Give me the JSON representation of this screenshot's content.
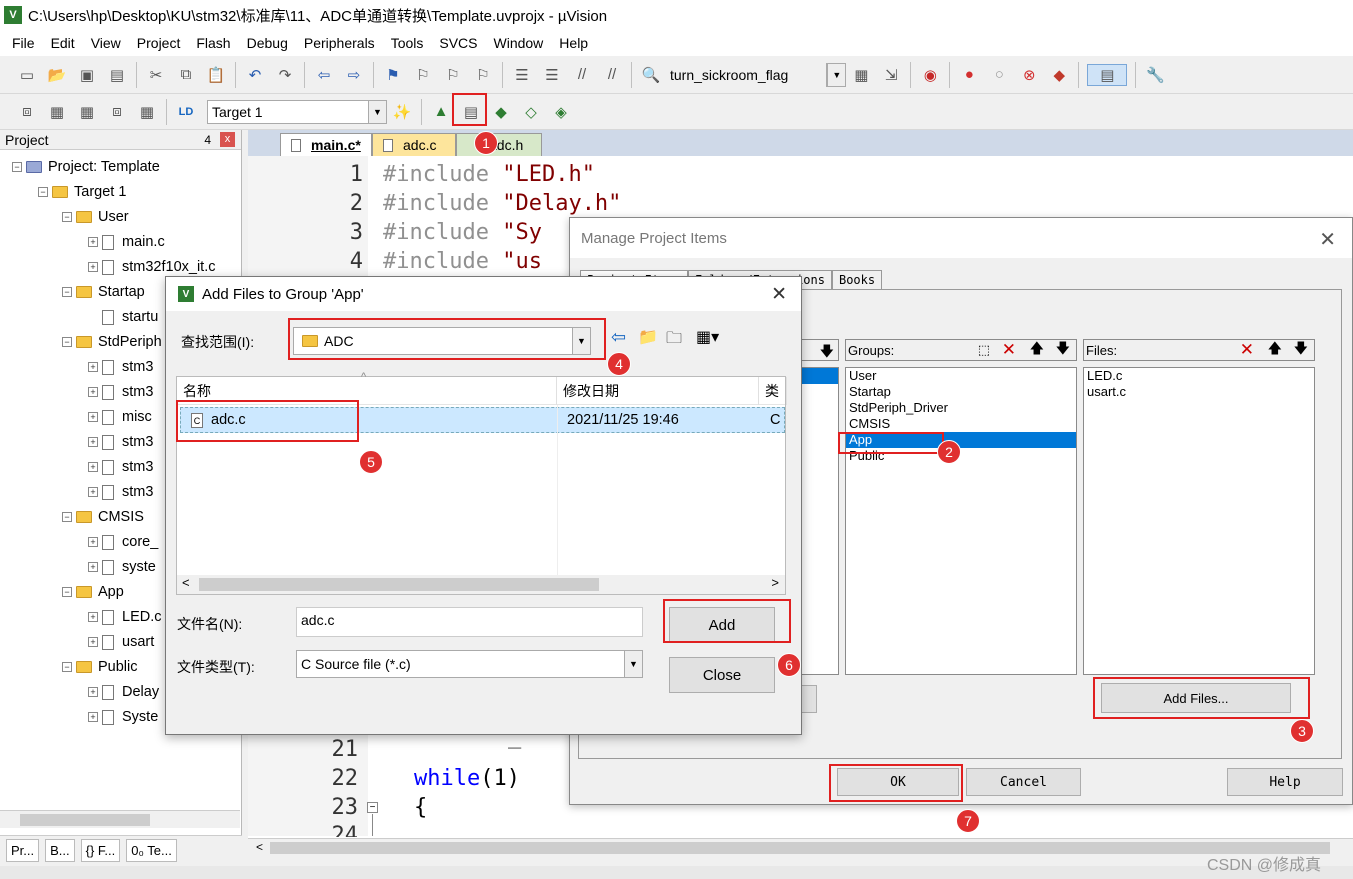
{
  "window": {
    "title": "C:\\Users\\hp\\Desktop\\KU\\stm32\\标准库\\11、ADC单通道转换\\Template.uvprojx - µVision"
  },
  "menu": [
    "File",
    "Edit",
    "View",
    "Project",
    "Flash",
    "Debug",
    "Peripherals",
    "Tools",
    "SVCS",
    "Window",
    "Help"
  ],
  "toolbar": {
    "find_combo": "turn_sickroom_flag",
    "target_combo": "Target 1"
  },
  "project_pane": {
    "title": "Project",
    "pin": "4",
    "close": "x",
    "tree": [
      {
        "label": "Project: Template"
      },
      {
        "label": "Target 1"
      },
      {
        "label": "User"
      },
      {
        "label": "main.c"
      },
      {
        "label": "stm32f10x_it.c"
      },
      {
        "label": "Startap"
      },
      {
        "label": "startu"
      },
      {
        "label": "StdPeriph"
      },
      {
        "label": "stm3"
      },
      {
        "label": "stm3"
      },
      {
        "label": "misc"
      },
      {
        "label": "stm3"
      },
      {
        "label": "stm3"
      },
      {
        "label": "stm3"
      },
      {
        "label": "CMSIS"
      },
      {
        "label": "core_"
      },
      {
        "label": "syste"
      },
      {
        "label": "App"
      },
      {
        "label": "LED.c"
      },
      {
        "label": "usart"
      },
      {
        "label": "Public"
      },
      {
        "label": "Delay"
      },
      {
        "label": "Syste"
      }
    ],
    "tabs": [
      "Pr...",
      "B...",
      "{} F...",
      "0₀ Te..."
    ]
  },
  "editor": {
    "tabs": [
      "main.c*",
      "adc.c",
      "adc.h"
    ],
    "lines": [
      {
        "n": "1",
        "pp": "#include",
        "str": "\"LED.h\""
      },
      {
        "n": "2",
        "pp": "#include",
        "str": "\"Delay.h\""
      },
      {
        "n": "3",
        "pp": "#include",
        "str": "\"Sy"
      },
      {
        "n": "4",
        "pp": "#include",
        "str": "\"us"
      }
    ],
    "lower_lines": [
      {
        "n": "21",
        "text": ""
      },
      {
        "n": "22",
        "kw": "while",
        "rest": "(1)"
      },
      {
        "n": "23",
        "text": "{"
      },
      {
        "n": "24",
        "text": ""
      }
    ]
  },
  "manage_dialog": {
    "title": "Manage Project Items",
    "tabs": [
      "Project Items",
      "Folders/Extensions",
      "Books"
    ],
    "groups_label": "Groups:",
    "groups": [
      "User",
      "Startap",
      "StdPeriph_Driver",
      "CMSIS",
      "App",
      "Public"
    ],
    "selected_group": "App",
    "files_label": "Files:",
    "files": [
      "LED.c",
      "usart.c"
    ],
    "add_files_button": "Add Files...",
    "ok": "OK",
    "cancel": "Cancel",
    "help": "Help"
  },
  "add_dialog": {
    "title": "Add Files to Group 'App'",
    "lookin_label": "查找范围(I):",
    "lookin_value": "ADC",
    "col_name": "名称",
    "col_date": "修改日期",
    "col_type": "类",
    "file": {
      "name": "adc.c",
      "date": "2021/11/25 19:46",
      "type": "C"
    },
    "filename_label": "文件名(N):",
    "filename_value": "adc.c",
    "filetype_label": "文件类型(T):",
    "filetype_value": "C Source file (*.c)",
    "add": "Add",
    "close": "Close"
  },
  "badges": [
    "1",
    "2",
    "3",
    "4",
    "5",
    "6",
    "7"
  ],
  "watermark": "CSDN @修成真",
  "colors": {
    "annotation_red": "#e02020",
    "selection_blue": "#0078d7"
  }
}
